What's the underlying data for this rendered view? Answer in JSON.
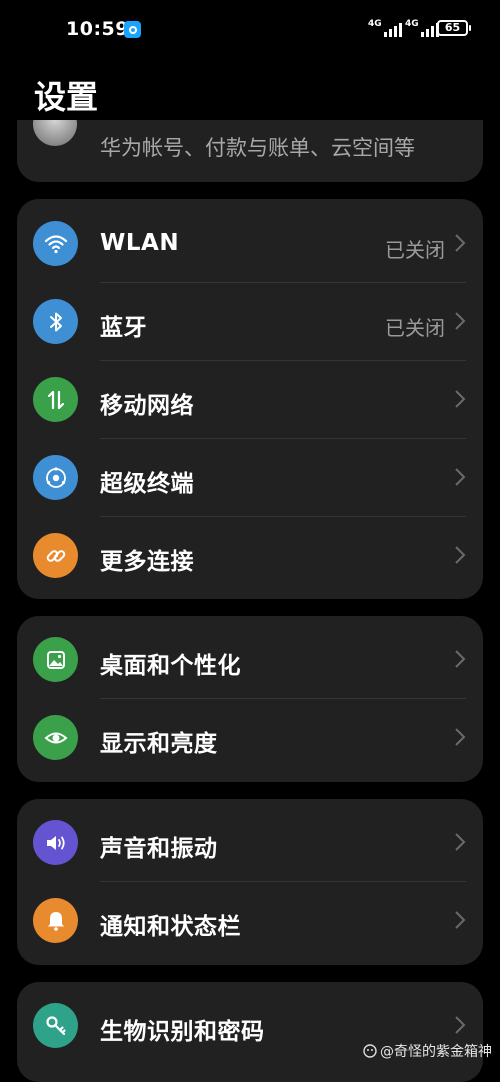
{
  "status_bar": {
    "time": "10:59",
    "net1": "4G",
    "net2": "4G",
    "battery": "65"
  },
  "page_title": "设置",
  "account": {
    "subtitle": "华为帐号、付款与账单、云空间等"
  },
  "groups": [
    {
      "items": [
        {
          "label": "WLAN",
          "status": "已关闭",
          "icon": "wifi-icon",
          "color": "#3f8fd4"
        },
        {
          "label": "蓝牙",
          "status": "已关闭",
          "icon": "bluetooth-icon",
          "color": "#3f8fd4"
        },
        {
          "label": "移动网络",
          "status": "",
          "icon": "mobile-data-icon",
          "color": "#3aa04a"
        },
        {
          "label": "超级终端",
          "status": "",
          "icon": "super-device-icon",
          "color": "#3f8fd4"
        },
        {
          "label": "更多连接",
          "status": "",
          "icon": "link-icon",
          "color": "#e88a2e"
        }
      ]
    },
    {
      "items": [
        {
          "label": "桌面和个性化",
          "status": "",
          "icon": "wallpaper-icon",
          "color": "#3aa04a"
        },
        {
          "label": "显示和亮度",
          "status": "",
          "icon": "eye-icon",
          "color": "#3aa04a"
        }
      ]
    },
    {
      "items": [
        {
          "label": "声音和振动",
          "status": "",
          "icon": "speaker-icon",
          "color": "#6454d1"
        },
        {
          "label": "通知和状态栏",
          "status": "",
          "icon": "bell-icon",
          "color": "#e88a2e"
        }
      ]
    },
    {
      "items": [
        {
          "label": "生物识别和密码",
          "status": "",
          "icon": "key-icon",
          "color": "#2fa28a"
        }
      ]
    }
  ],
  "watermark": "@奇怪的紫金箱神"
}
